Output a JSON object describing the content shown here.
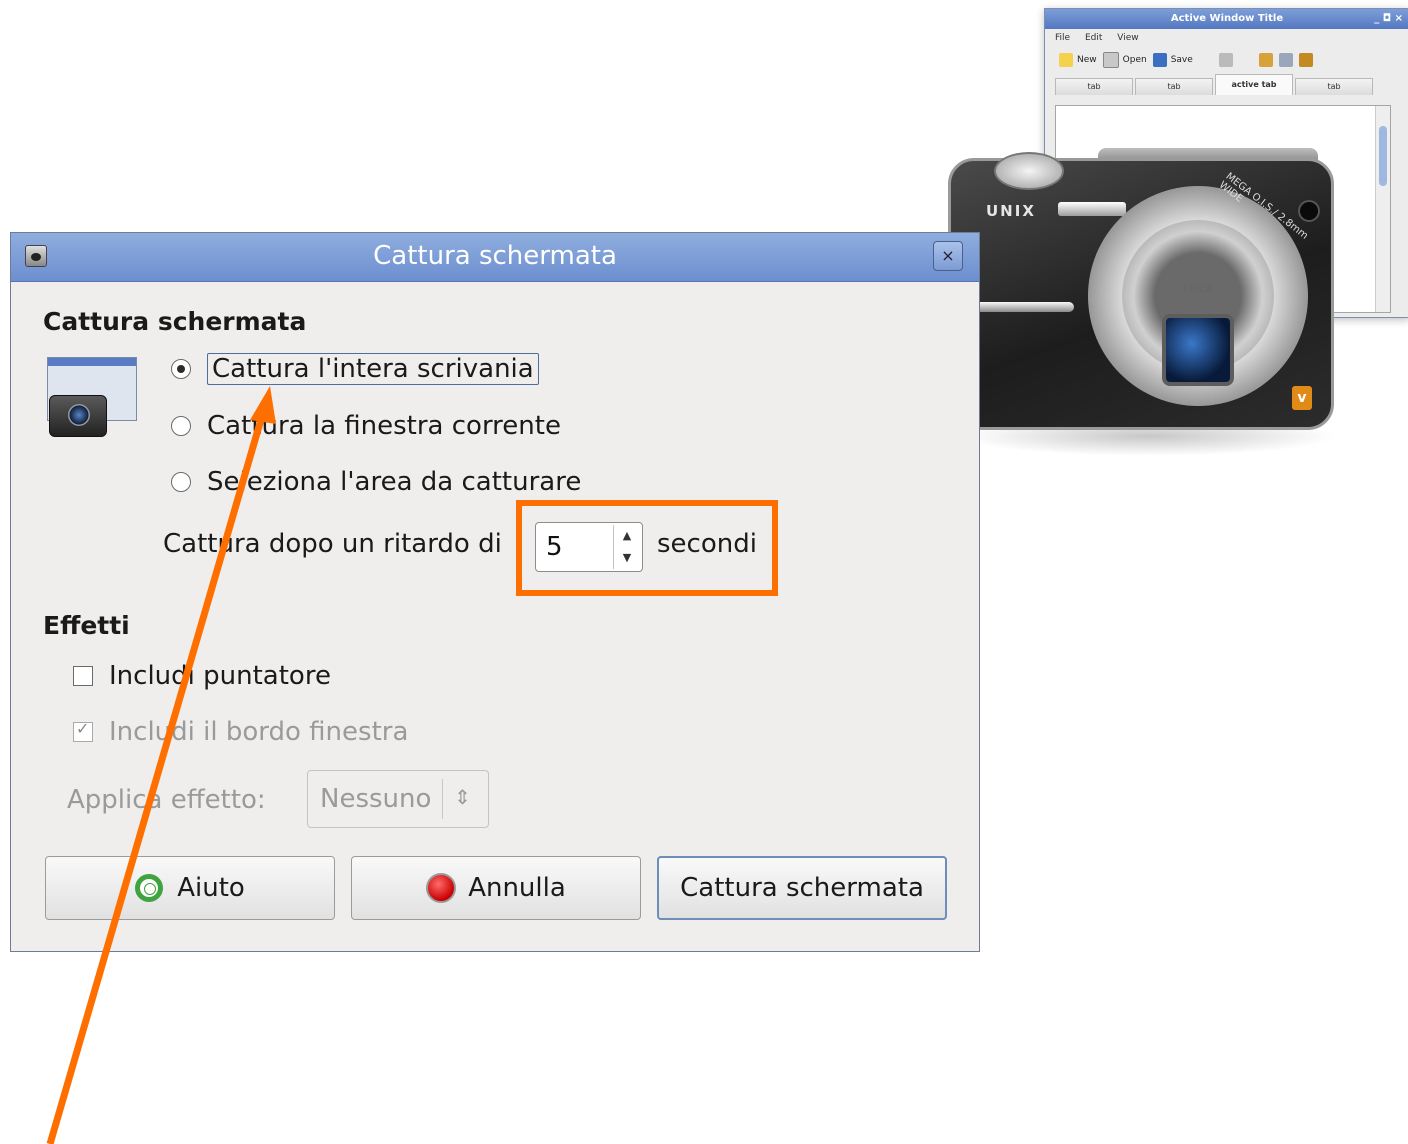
{
  "background_window": {
    "title": "Active Window Title",
    "controls": "_ ◘ ×",
    "menu": [
      "File",
      "Edit",
      "View"
    ],
    "toolbar": [
      {
        "label": "New",
        "icon": "new-document-icon"
      },
      {
        "label": "Open",
        "icon": "open-folder-icon"
      },
      {
        "label": "Save",
        "icon": "save-disk-icon"
      }
    ],
    "tabs": [
      "tab",
      "tab",
      "active tab",
      "tab"
    ],
    "active_tab_index": 2
  },
  "camera": {
    "brand": "UNIX",
    "lens_text": "MEGA O.I.S./ 2.8mm WIDE",
    "lens_brand": "LEICA"
  },
  "dialog": {
    "title": "Cattura schermata",
    "close_glyph": "×",
    "capture_section": {
      "heading": "Cattura schermata",
      "options": [
        {
          "label": "Cattura l'intera scrivania",
          "checked": true
        },
        {
          "label": "Cattura la finestra corrente",
          "checked": false
        },
        {
          "label": "Seleziona l'area da catturare",
          "checked": false
        }
      ],
      "delay_label": "Cattura dopo un ritardo di",
      "delay_value": "5",
      "delay_unit": "secondi"
    },
    "effects_section": {
      "heading": "Effetti",
      "include_pointer": {
        "label": "Includi puntatore",
        "checked": false
      },
      "include_border": {
        "label": "Includi il bordo finestra",
        "checked": true,
        "disabled": true
      },
      "apply_effect_label": "Applica effetto:",
      "apply_effect_value": "Nessuno"
    },
    "buttons": {
      "help": "Aiuto",
      "cancel": "Annulla",
      "capture": "Cattura schermata"
    }
  },
  "annotations": {
    "highlight_color": "#ff6f00",
    "arrow_color": "#ff6f00"
  }
}
